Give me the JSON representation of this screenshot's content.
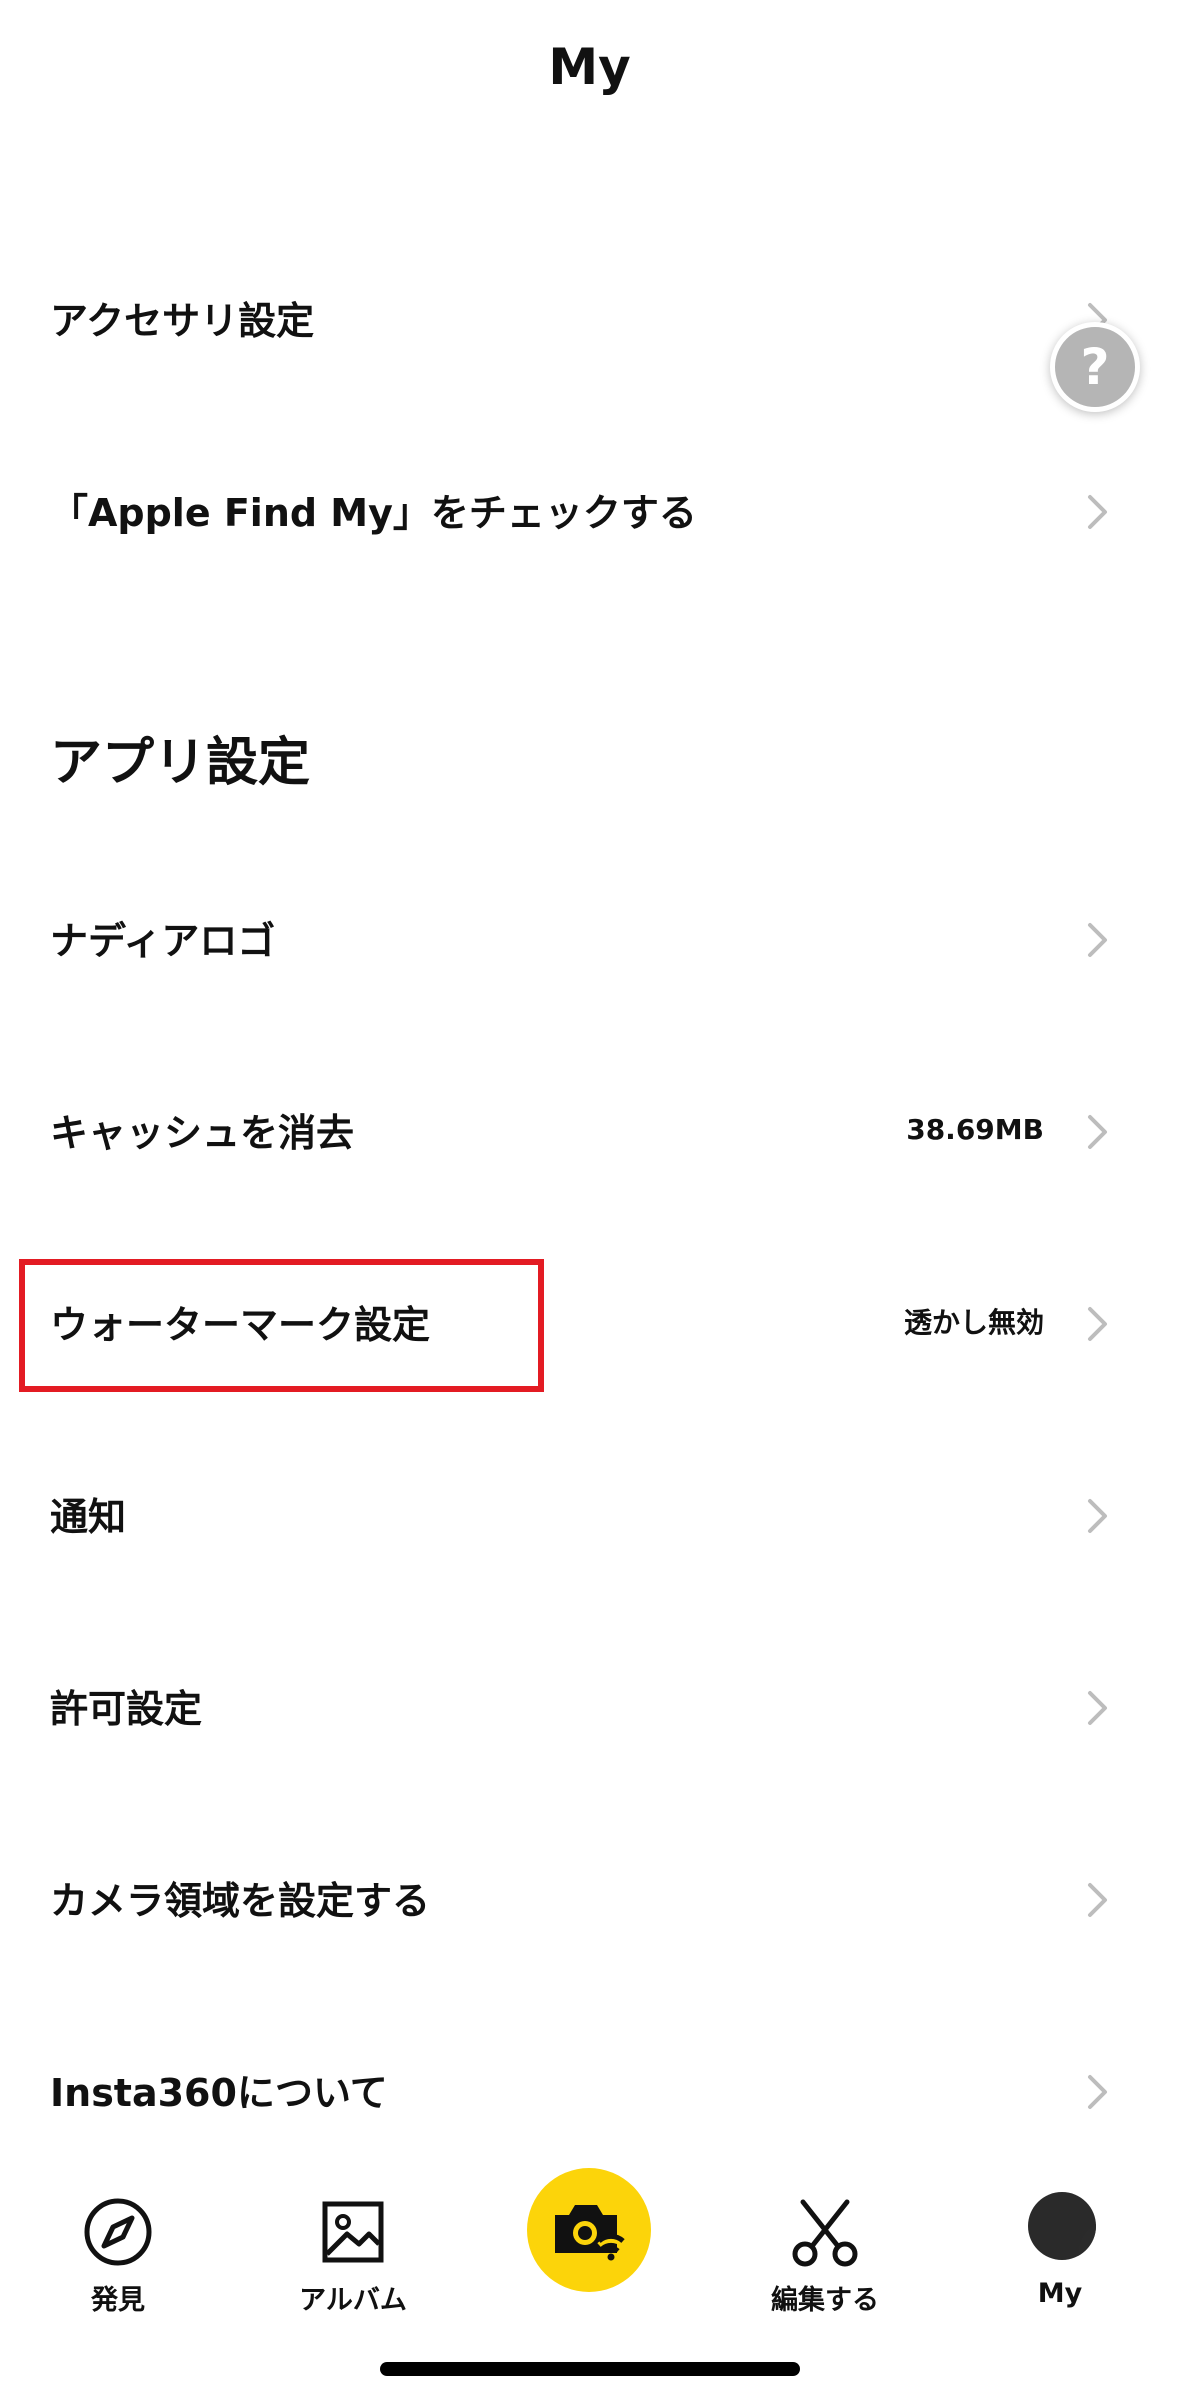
{
  "header": {
    "title": "My"
  },
  "device_section": {
    "items": [
      {
        "label": "アクセサリ設定"
      },
      {
        "label": "「Apple Find My」をチェックする"
      }
    ]
  },
  "app_settings": {
    "title": "アプリ設定",
    "items": [
      {
        "label": "ナディアロゴ",
        "value": ""
      },
      {
        "label": "キャッシュを消去",
        "value": "38.69MB"
      },
      {
        "label": "ウォーターマーク設定",
        "value": "透かし無効"
      },
      {
        "label": "通知",
        "value": ""
      },
      {
        "label": "許可設定",
        "value": ""
      },
      {
        "label": "カメラ領域を設定する",
        "value": ""
      },
      {
        "label": "Insta360について",
        "value": ""
      }
    ]
  },
  "help": {
    "icon": "question-icon",
    "glyph": "?"
  },
  "tabbar": {
    "tabs": [
      {
        "label": "発見",
        "icon": "compass-icon"
      },
      {
        "label": "アルバム",
        "icon": "image-icon"
      },
      {
        "label": "",
        "icon": "camera-wifi-icon"
      },
      {
        "label": "編集する",
        "icon": "scissors-icon"
      },
      {
        "label": "My",
        "icon": "avatar"
      }
    ],
    "accent": "#fcd40a"
  },
  "highlight_color": "#e31b23"
}
